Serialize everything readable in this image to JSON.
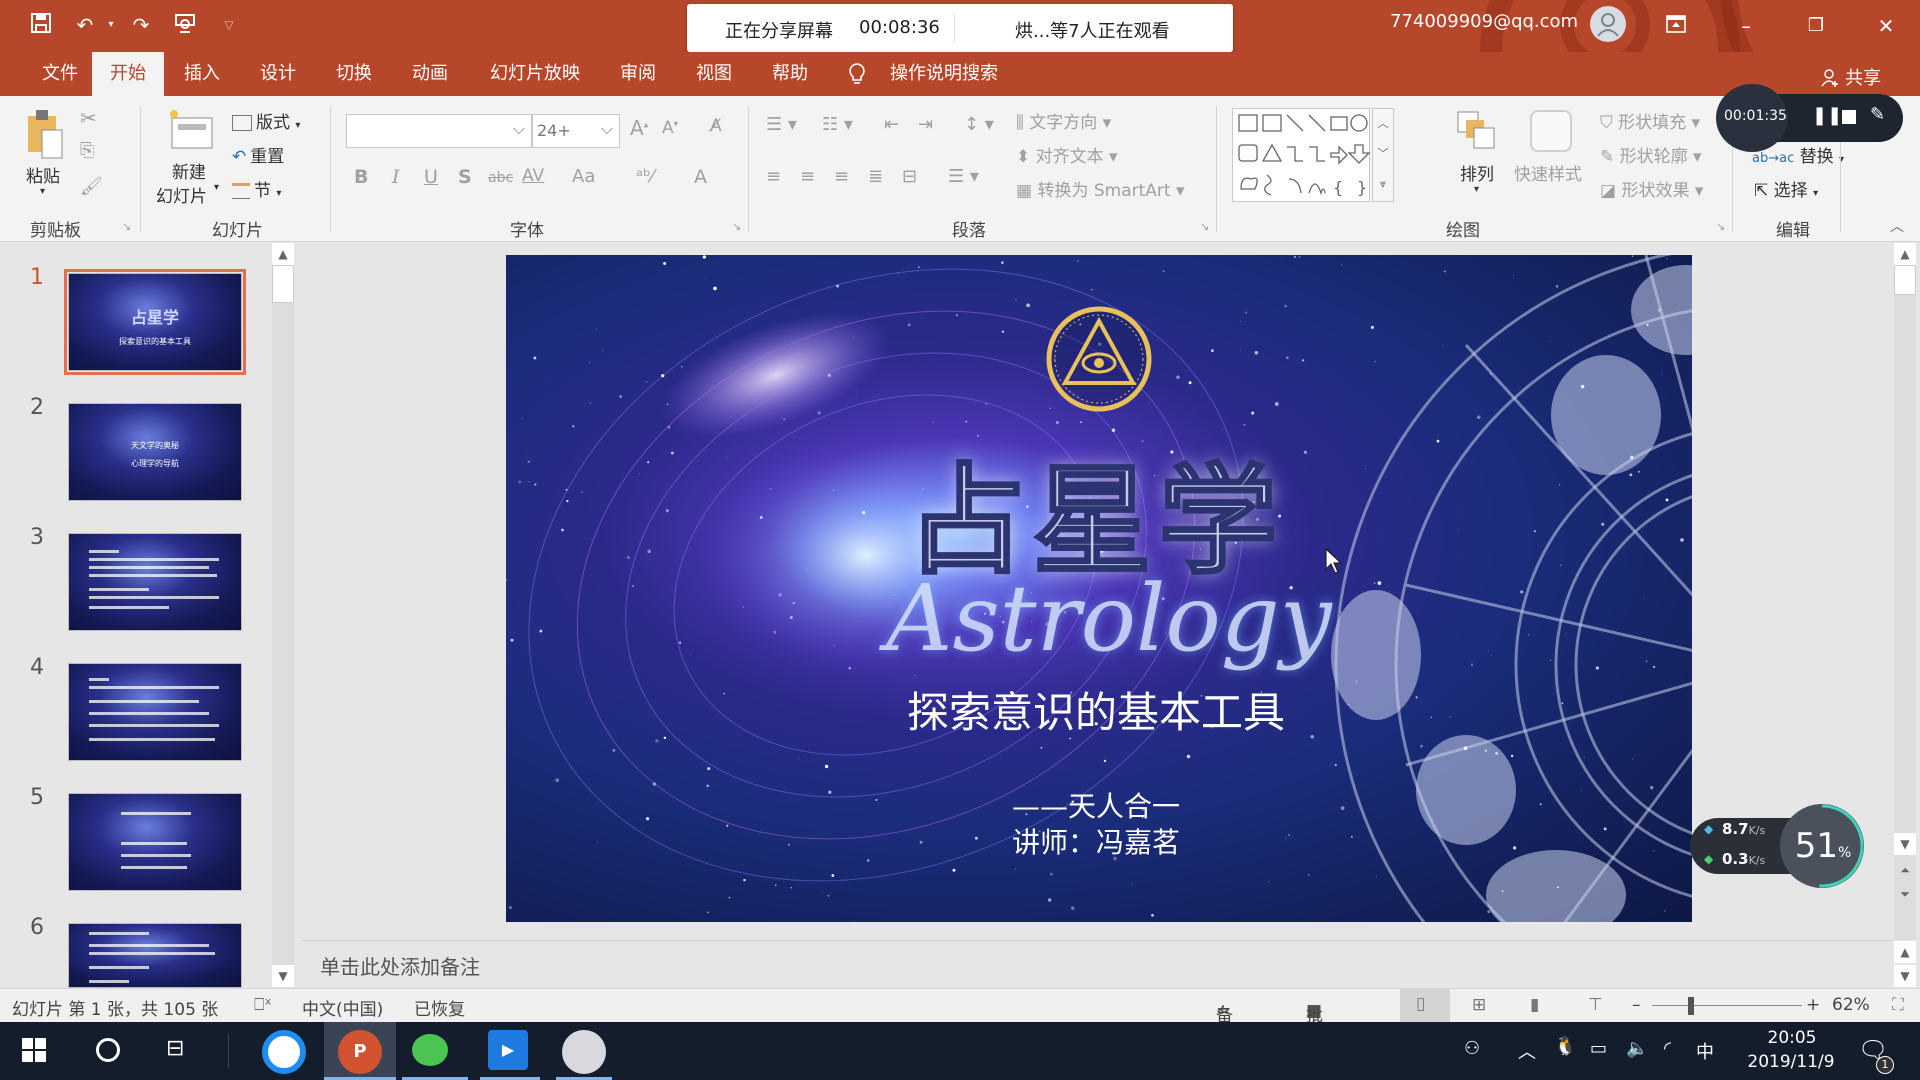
{
  "window": {
    "account": "774009909@qq.com",
    "share_label": "共享"
  },
  "quick_access": {
    "icons": [
      "save-icon",
      "undo-icon",
      "redo-icon",
      "start-from-beginning-icon",
      "customize-icon"
    ]
  },
  "share_banner": {
    "status": "正在分享屏幕",
    "elapsed": "00:08:36",
    "viewers": "烘...等7人正在观看"
  },
  "tabs": [
    {
      "label": "文件",
      "active": false
    },
    {
      "label": "开始",
      "active": true
    },
    {
      "label": "插入",
      "active": false
    },
    {
      "label": "设计",
      "active": false
    },
    {
      "label": "切换",
      "active": false
    },
    {
      "label": "动画",
      "active": false
    },
    {
      "label": "幻灯片放映",
      "active": false
    },
    {
      "label": "审阅",
      "active": false
    },
    {
      "label": "视图",
      "active": false
    },
    {
      "label": "帮助",
      "active": false
    }
  ],
  "tell_me": "操作说明搜索",
  "ribbon": {
    "clipboard": {
      "label": "剪贴板",
      "paste": "粘贴"
    },
    "slides": {
      "label": "幻灯片",
      "new_slide_1": "新建",
      "new_slide_2": "幻灯片",
      "layout": "版式",
      "reset": "重置",
      "section": "节"
    },
    "font": {
      "label": "字体",
      "font_name": "",
      "font_size": "24+",
      "bold": "B",
      "italic": "I",
      "underline": "U",
      "shadow": "S",
      "strike": "abc",
      "spacing": "AV",
      "case": "Aa",
      "color": "A"
    },
    "paragraph": {
      "label": "段落",
      "text_direction": "文字方向",
      "align_text": "对齐文本",
      "smartart": "转换为 SmartArt"
    },
    "drawing": {
      "label": "绘图",
      "arrange": "排列",
      "quick_styles": "快速样式",
      "shape_fill": "形状填充",
      "shape_outline": "形状轮廓",
      "shape_effects": "形状效果"
    },
    "editing": {
      "label": "编辑",
      "replace": "替换",
      "select": "选择"
    }
  },
  "recorder": {
    "time": "00:01:35"
  },
  "thumbnails": [
    {
      "num": "1",
      "selected": true,
      "title": "占星学",
      "sub": "探索意识的基本工具"
    },
    {
      "num": "2",
      "selected": false,
      "title": "天文学的奥秘",
      "sub": "心理学的导航"
    },
    {
      "num": "3",
      "selected": false,
      "title": "",
      "sub": ""
    },
    {
      "num": "4",
      "selected": false,
      "title": "",
      "sub": ""
    },
    {
      "num": "5",
      "selected": false,
      "title": "",
      "sub": ""
    },
    {
      "num": "6",
      "selected": false,
      "title": "",
      "sub": ""
    }
  ],
  "slide": {
    "title_cn": "占星学",
    "title_en": "Astrology",
    "subtitle": "探索意识的基本工具",
    "motto": "——天人合一",
    "lecturer": "讲师：冯嘉茗"
  },
  "notes_placeholder": "单击此处添加备注",
  "network": {
    "upload": "8.7",
    "download": "0.3",
    "unit": "K/s",
    "cpu_percent": 51
  },
  "status": {
    "slide_info": "幻灯片 第 1 张，共 105 张",
    "language": "中文(中国)",
    "recovered": "已恢复",
    "notes": "备注",
    "comments": "批注",
    "zoom": "62%"
  },
  "taskbar": {
    "time": "20:05",
    "date": "2019/11/9",
    "ime": "中",
    "notifications": "1",
    "apps": [
      "qq-browser",
      "powerpoint",
      "wechat",
      "tencent-meeting",
      "qq-avatar"
    ]
  }
}
